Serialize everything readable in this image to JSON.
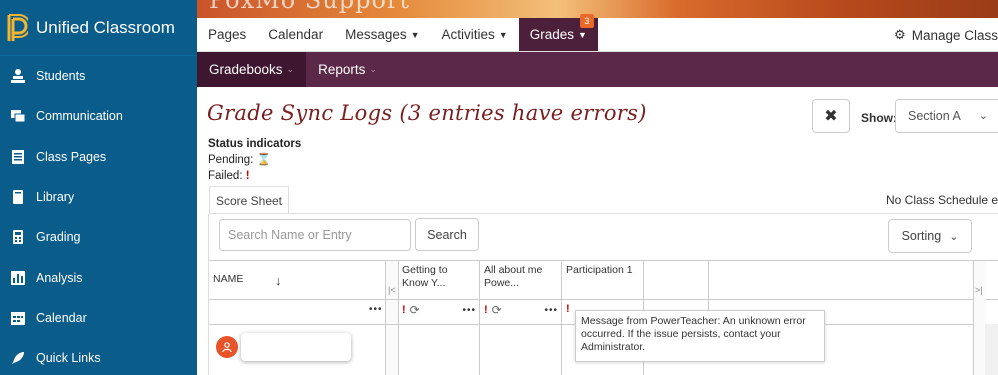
{
  "app": {
    "title": "Unified Classroom",
    "banner_title": "PoxMo Support"
  },
  "sidebar": {
    "items": [
      {
        "label": "Students",
        "icon": "students-icon"
      },
      {
        "label": "Communication",
        "icon": "communication-icon"
      },
      {
        "label": "Class Pages",
        "icon": "class-pages-icon"
      },
      {
        "label": "Library",
        "icon": "library-icon"
      },
      {
        "label": "Grading",
        "icon": "grading-icon"
      },
      {
        "label": "Analysis",
        "icon": "analysis-icon"
      },
      {
        "label": "Calendar",
        "icon": "calendar-icon"
      },
      {
        "label": "Quick Links",
        "icon": "rocket-icon"
      }
    ]
  },
  "mainnav": {
    "items": [
      {
        "label": "Pages"
      },
      {
        "label": "Calendar"
      },
      {
        "label": "Messages"
      },
      {
        "label": "Activities"
      },
      {
        "label": "Grades",
        "badge": "3"
      }
    ],
    "manage_label": "Manage Class"
  },
  "subnav": {
    "items": [
      {
        "label": "Gradebooks"
      },
      {
        "label": "Reports"
      }
    ]
  },
  "page": {
    "title": "Grade Sync Logs (3 entries have errors)",
    "show_label": "Show:",
    "show_value": "Section A",
    "status_heading": "Status indicators",
    "pending_label": "Pending:",
    "failed_label": "Failed:",
    "failed_symbol": "!",
    "tab_label": "Score Sheet",
    "no_class_schedule": "No Class Schedule edit",
    "search_placeholder": "Search Name or Entry",
    "search_button": "Search",
    "sorting_button": "Sorting"
  },
  "grid": {
    "name_header": "NAME",
    "assignments": [
      {
        "title": "Getting to Know Y..."
      },
      {
        "title": "All about me Powe..."
      },
      {
        "title": "Participation 1"
      }
    ],
    "tooltip": "Message from PowerTeacher: An unknown error occurred. If the issue persists, contact your Administrator."
  },
  "colors": {
    "sidebar_bg": "#0a5c8a",
    "subnav_bg": "#5c2848",
    "active_nav": "#4c1f3a",
    "title_color": "#7a1e1e",
    "error_red": "#d10000",
    "badge_orange": "#e8692a"
  }
}
